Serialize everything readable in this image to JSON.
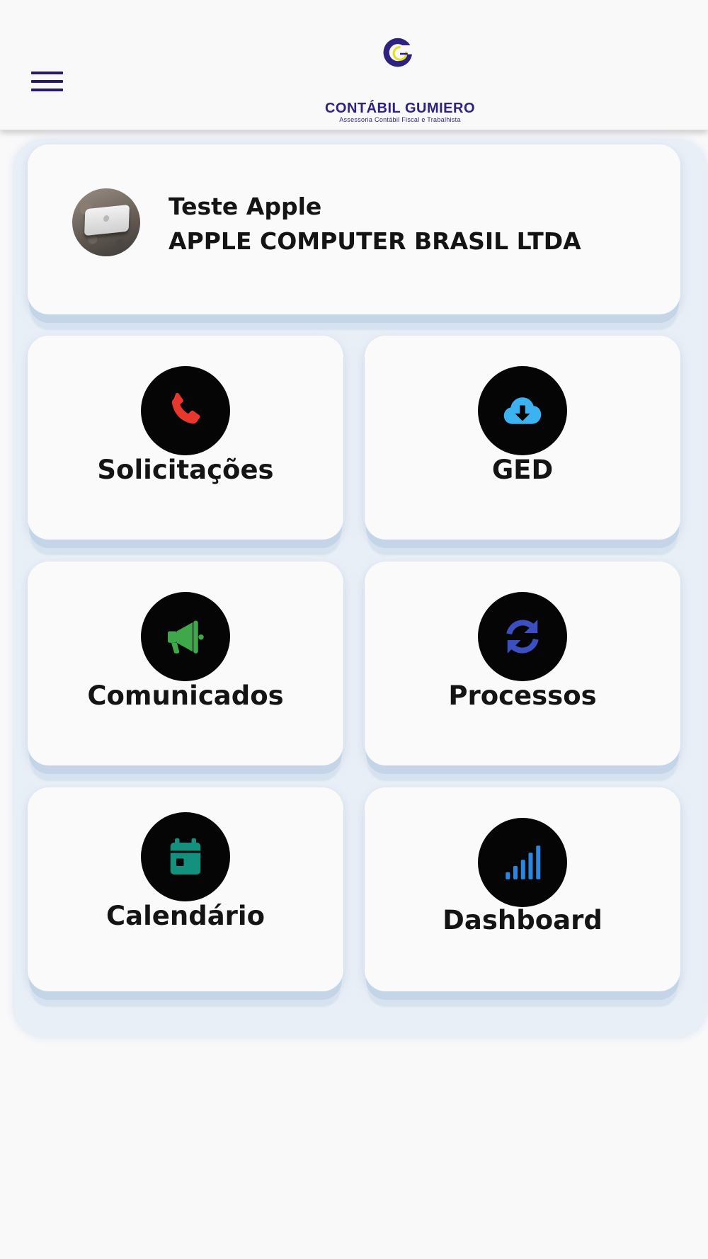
{
  "header": {
    "menu_icon": "hamburger-menu-icon",
    "logo_name": "CONTÁBIL GUMIERO",
    "logo_subtitle": "Assessoria Contábil Fiscal e Trabalhista",
    "brand_colors": {
      "primary": "#2e2280",
      "accent": "#e8df2a"
    }
  },
  "profile": {
    "user_name": "Teste Apple",
    "company": "APPLE COMPUTER BRASIL LTDA",
    "avatar_icon": "user-avatar-photo"
  },
  "tiles": [
    {
      "label": "Solicitações",
      "icon": "phone-icon",
      "icon_color": "#e8372c"
    },
    {
      "label": "GED",
      "icon": "cloud-download-icon",
      "icon_color": "#3db2f0"
    },
    {
      "label": "Comunicados",
      "icon": "megaphone-icon",
      "icon_color": "#3ea84a"
    },
    {
      "label": "Processos",
      "icon": "sync-icon",
      "icon_color": "#3b4fc0"
    },
    {
      "label": "Calendário",
      "icon": "calendar-icon",
      "icon_color": "#14907e"
    },
    {
      "label": "Dashboard",
      "icon": "signal-bars-icon",
      "icon_color": "#2b86e0"
    }
  ]
}
